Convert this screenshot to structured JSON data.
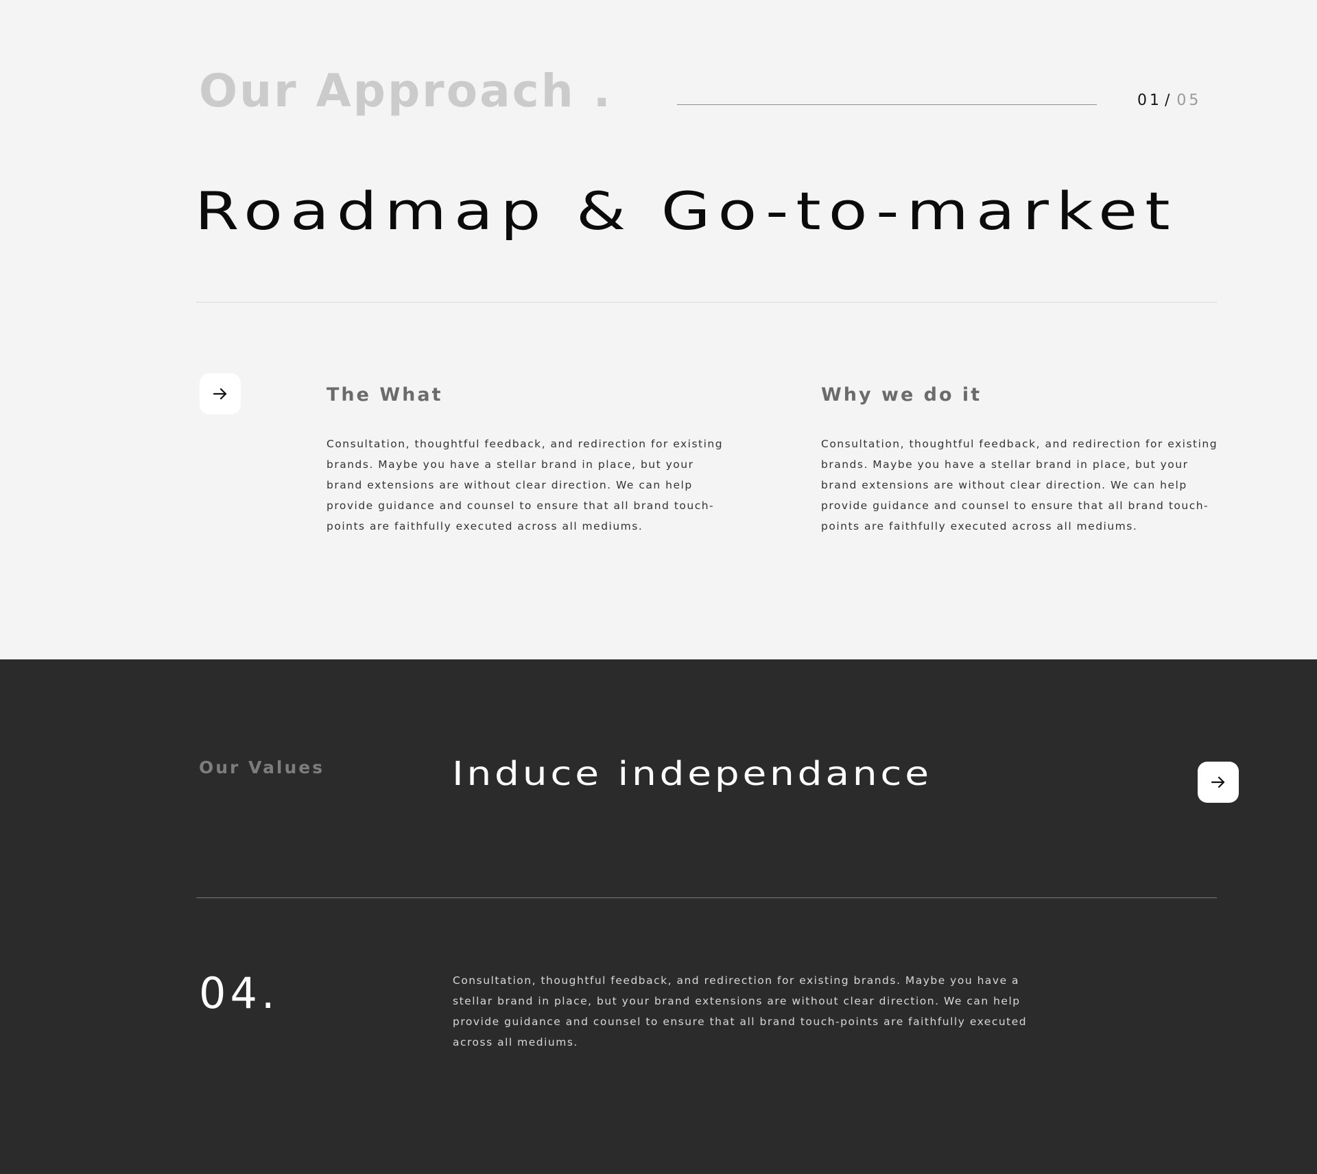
{
  "approach": {
    "section_label": "Our Approach",
    "section_label_dot": ".",
    "counter_current": "01",
    "counter_separator": "/",
    "counter_total": "05",
    "title": "Roadmap & Go-to-market",
    "arrow_icon": "arrow-right-icon",
    "what": {
      "heading": "The What",
      "text": "Consultation, thoughtful feedback, and redirection for existing brands. Maybe you have a stellar brand in place, but your brand extensions are without clear direction. We can help provide guidance and counsel to ensure that all brand touch-points are faithfully executed across all mediums."
    },
    "why": {
      "heading": "Why we do it",
      "text": "Consultation, thoughtful feedback, and redirection for existing brands. Maybe you have a stellar brand in place, but your brand extensions are without clear direction. We can help provide guidance and counsel to ensure that all brand touch-points are faithfully executed across all mediums."
    }
  },
  "values": {
    "label": "Our Values",
    "title": "Induce independance",
    "arrow_icon": "arrow-right-icon",
    "number": "04.",
    "text": "Consultation, thoughtful feedback, and redirection for existing brands. Maybe you have a stellar brand in place, but your brand extensions are without clear direction. We can help provide guidance and counsel to ensure that all brand touch-points are faithfully executed across all mediums."
  },
  "colors": {
    "light_background": "#f4f4f4",
    "dark_background": "#2b2b2b",
    "muted_label": "#cbcbcb",
    "heading_gray": "#6b6b6b",
    "button_background": "#ffffff",
    "primary_text": "#0b0b0b"
  }
}
